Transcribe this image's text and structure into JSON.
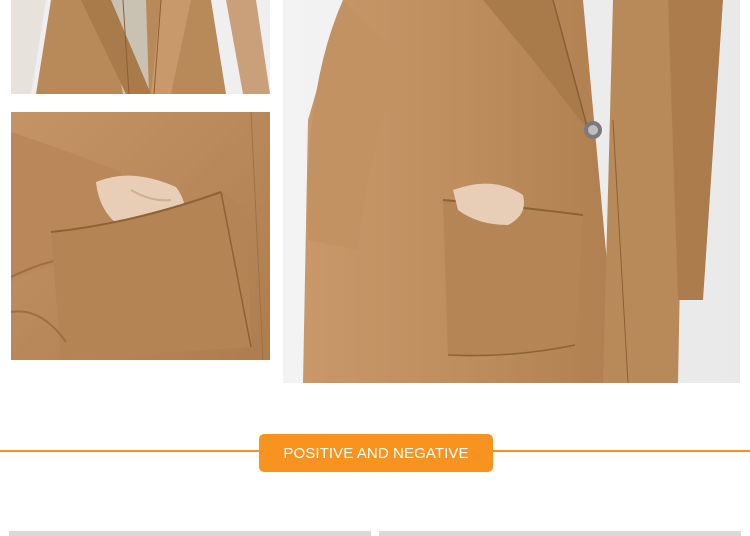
{
  "section": {
    "title": "POSITIVE AND NEGATIVE",
    "accent_color": "#f7931e"
  },
  "photos": [
    {
      "icon": "coat-collar-detail-photo"
    },
    {
      "icon": "coat-pocket-detail-photo"
    },
    {
      "icon": "coat-front-full-photo"
    }
  ],
  "colors": {
    "camel": "#b98a59",
    "camel_dark": "#9c6e40",
    "camel_light": "#cfa273",
    "lining": "#c9c2b3",
    "skin": "#e8cdb7",
    "background": "#efefef",
    "strip": "#d9d9d9"
  }
}
